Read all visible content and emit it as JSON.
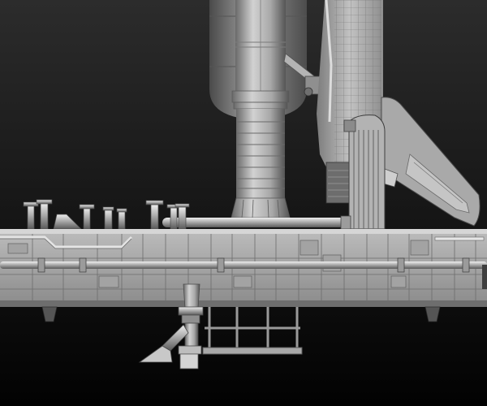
{
  "scene": {
    "subject": "shuttle-on-launch-platform",
    "render_style": "grey-clay-3d-render",
    "colors": {
      "background_top": "#2c2c2c",
      "background_bottom": "#020202",
      "metal_light": "#c9c9c9",
      "metal_mid": "#9a9a9a",
      "metal_dark": "#5e5e5e",
      "edge_dark": "#3a3a3a"
    }
  }
}
